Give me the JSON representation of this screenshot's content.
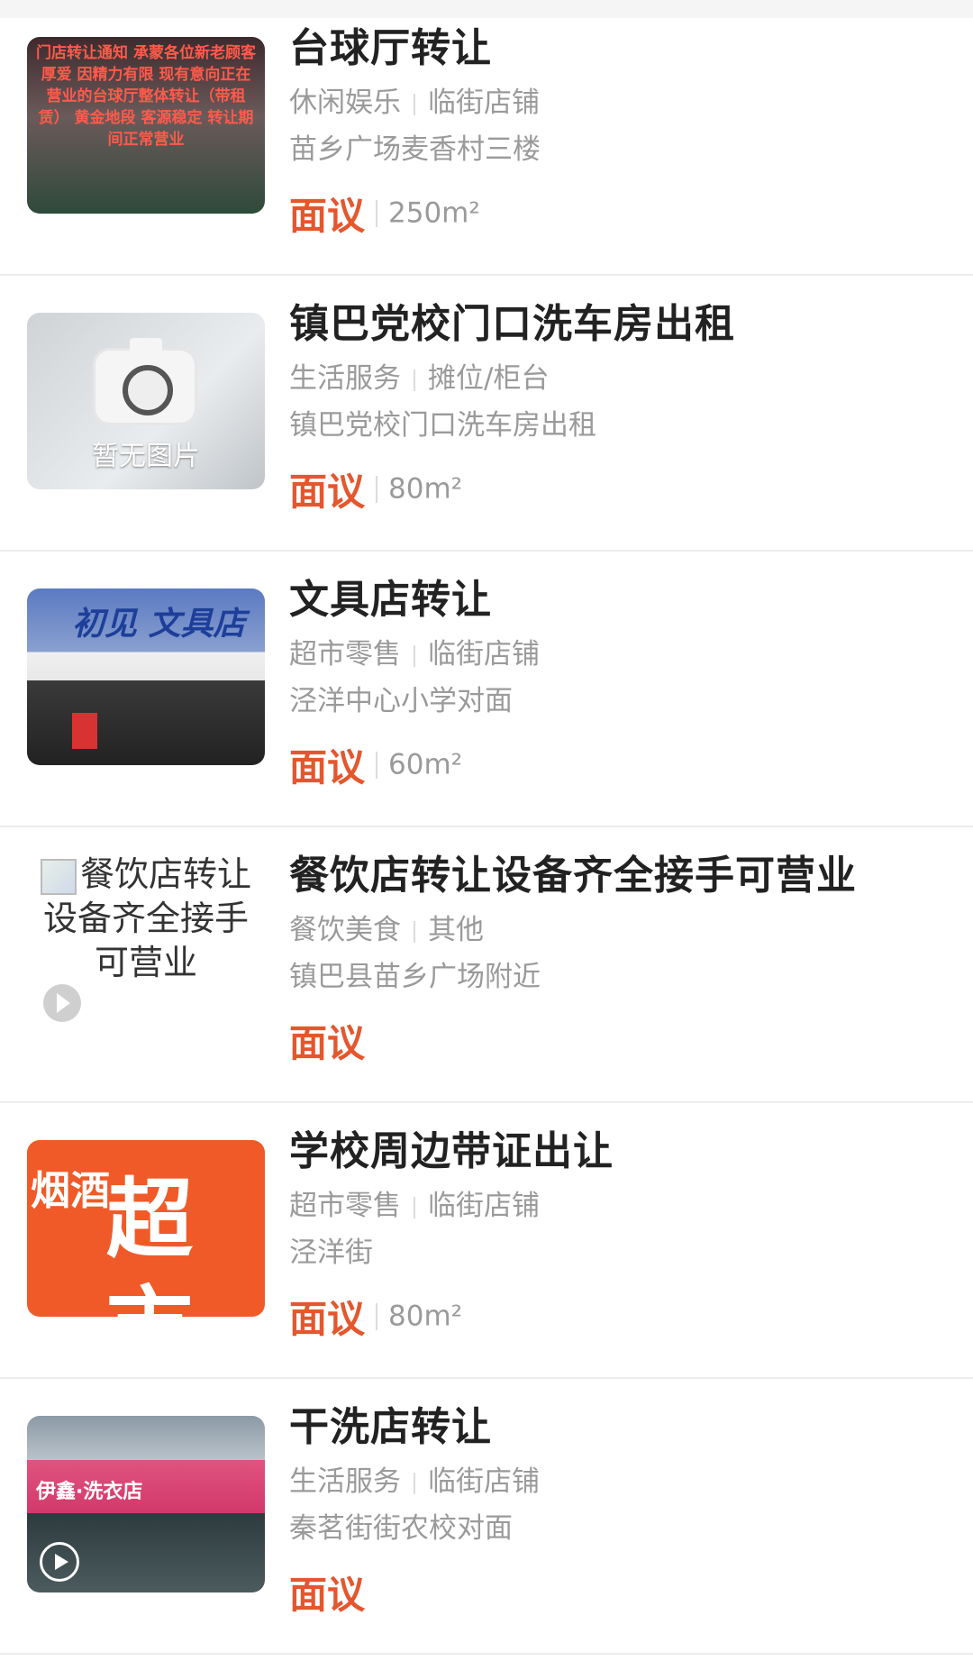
{
  "listings": [
    {
      "title": "台球厅转让",
      "category": "休闲娱乐",
      "type": "临街店铺",
      "address": "苗乡广场麦香村三楼",
      "price": "面议",
      "area": "250m²",
      "thumb_text": "门店转让通知 承蒙各位新老顾客厚爱 因精力有限 现有意向正在营业的台球厅整体转让（带租赁） 黄金地段 客源稳定 转让期间正常营业"
    },
    {
      "title": "镇巴党校门口洗车房出租",
      "category": "生活服务",
      "type": "摊位/柜台",
      "address": "镇巴党校门口洗车房出租",
      "price": "面议",
      "area": "80m²",
      "thumb_text": "暂无图片"
    },
    {
      "title": "文具店转让",
      "category": "超市零售",
      "type": "临街店铺",
      "address": "泾洋中心小学对面",
      "price": "面议",
      "area": "60m²",
      "thumb_text": "初见 文具店"
    },
    {
      "title": "餐饮店转让设备齐全接手可营业",
      "category": "餐饮美食",
      "type": "其他",
      "address": "镇巴县苗乡广场附近",
      "price": "面议",
      "area": "",
      "thumb_text": "餐饮店转让设备齐全接手可营业"
    },
    {
      "title": "学校周边带证出让",
      "category": "超市零售",
      "type": "临街店铺",
      "address": "泾洋街",
      "price": "面议",
      "area": "80m²",
      "thumb_text": "超市",
      "thumb_text_2": "烟酒"
    },
    {
      "title": "干洗店转让",
      "category": "生活服务",
      "type": "临街店铺",
      "address": "秦茗街街农校对面",
      "price": "面议",
      "area": "",
      "thumb_text": "伊鑫·洗衣店"
    }
  ]
}
